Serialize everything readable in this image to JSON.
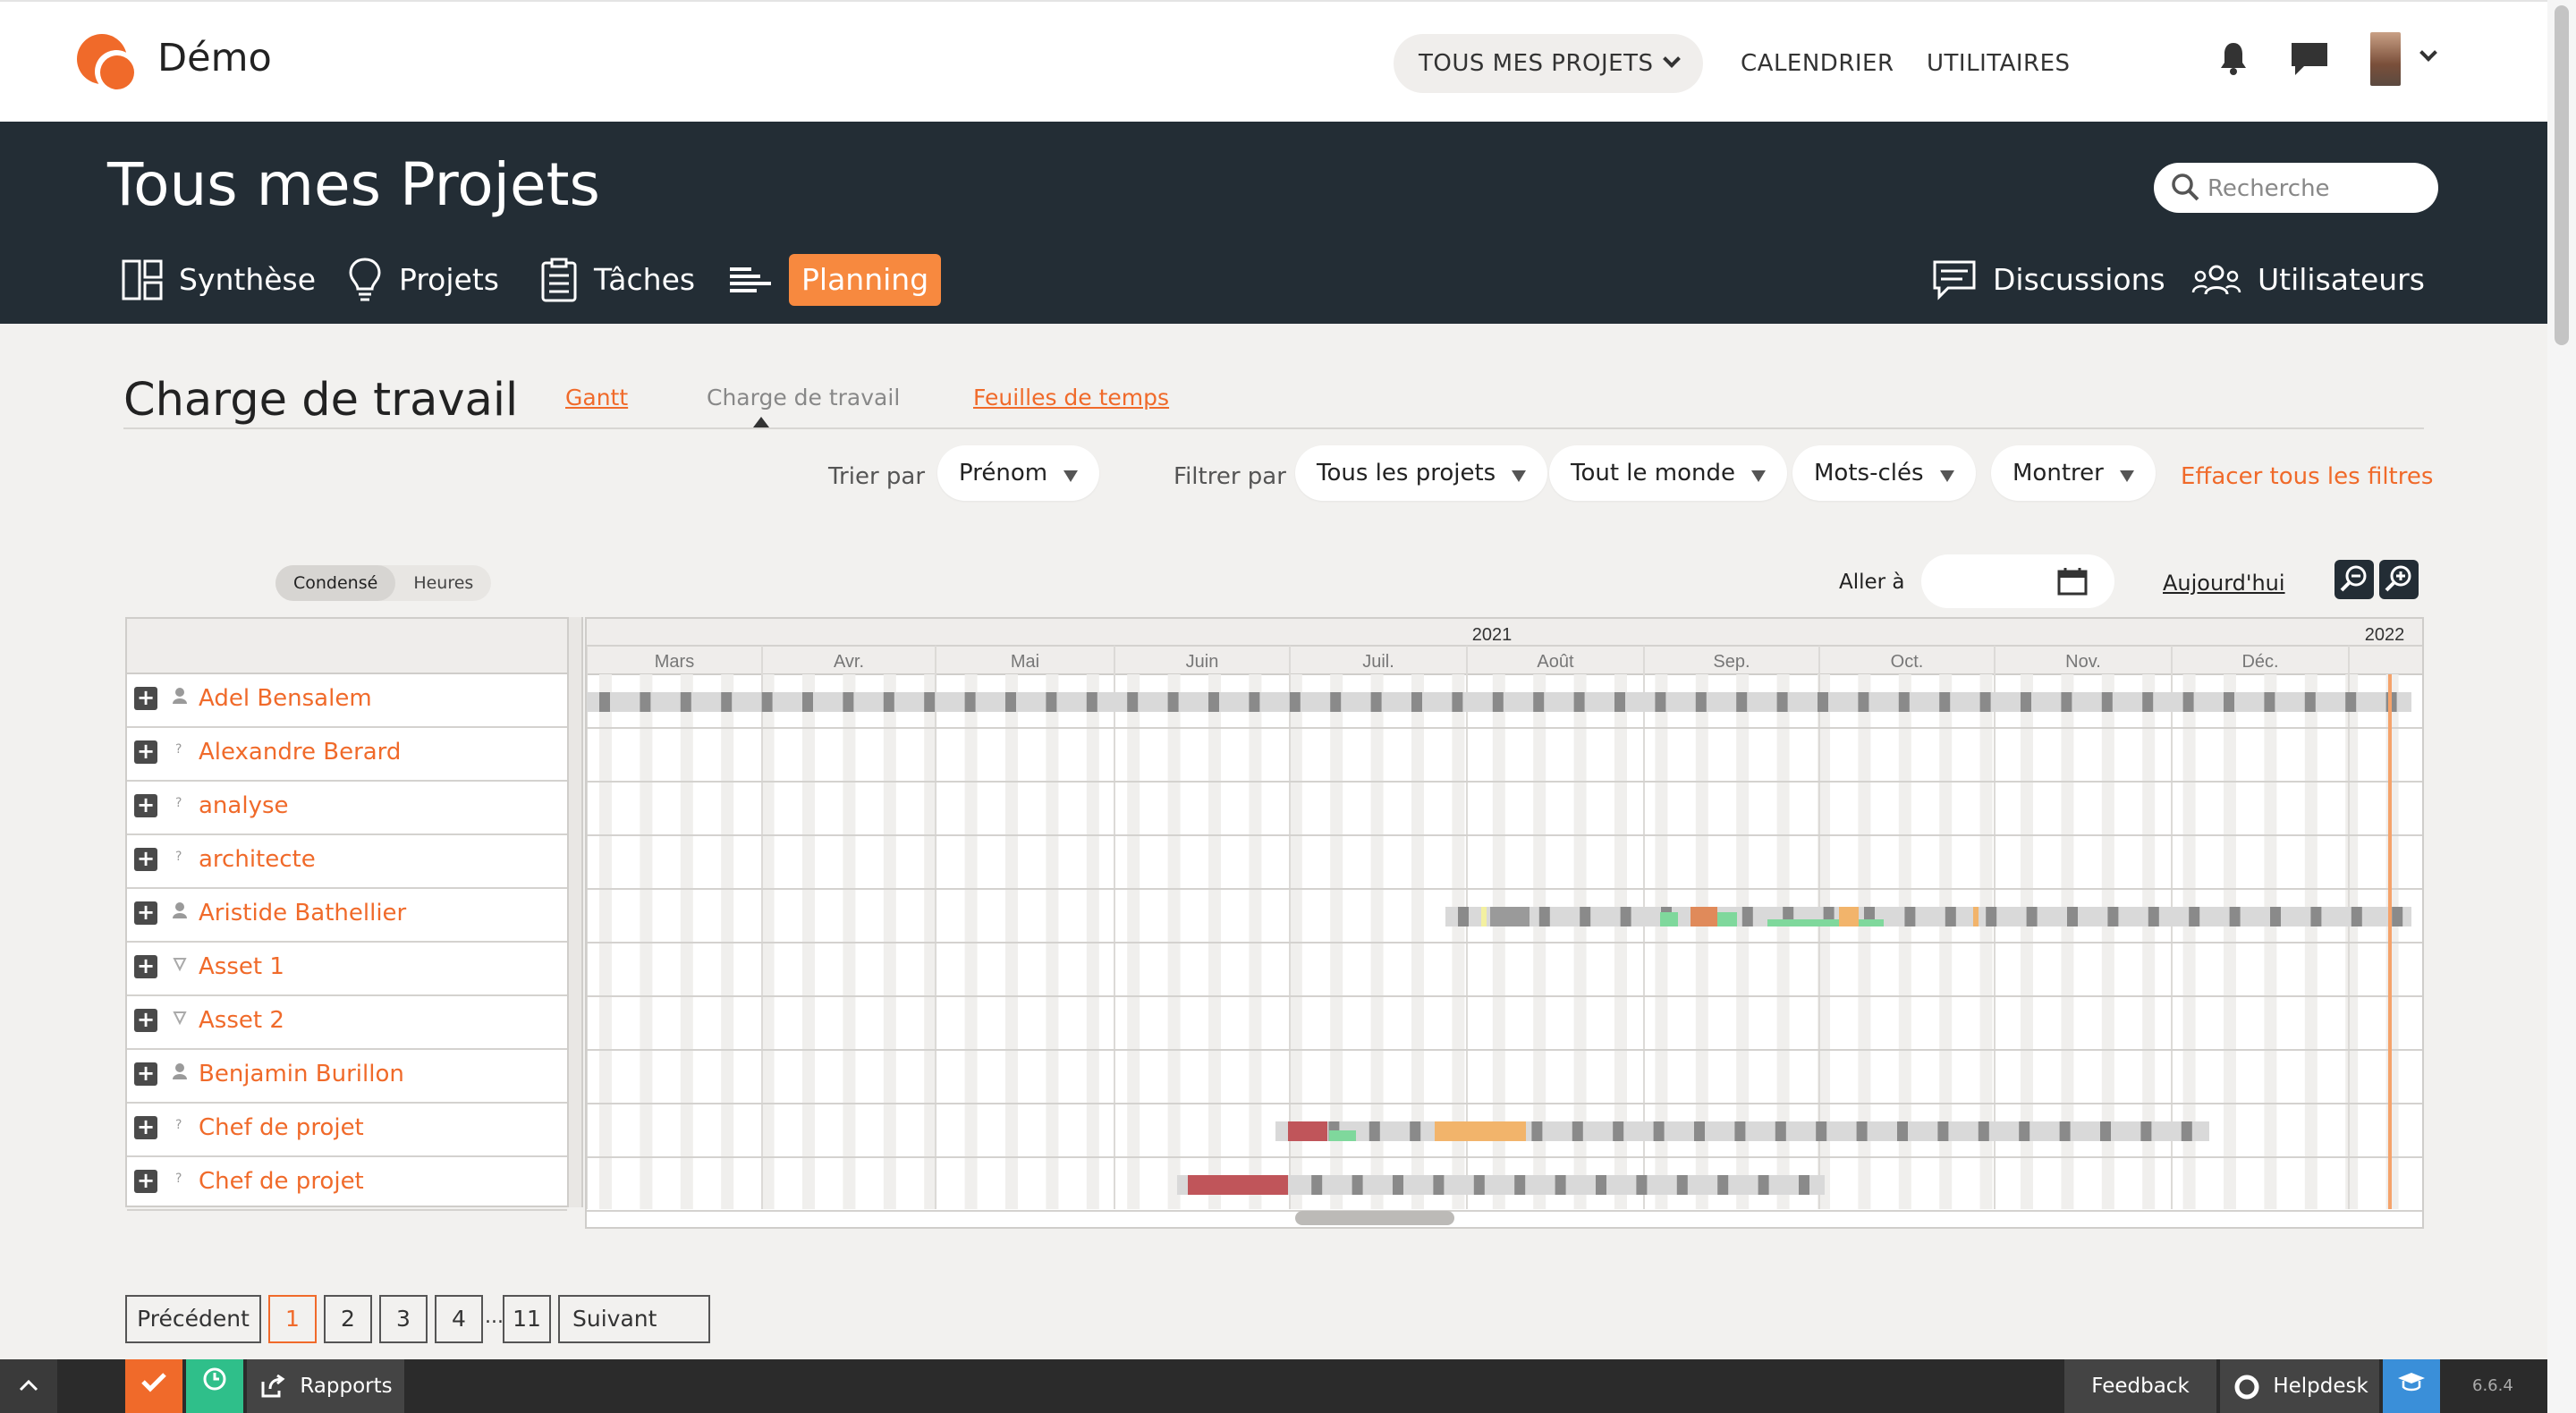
{
  "app": {
    "brand": "Démo",
    "topnav": {
      "projects_label": "TOUS MES PROJETS",
      "calendar_label": "CALENDRIER",
      "utilities_label": "UTILITAIRES"
    }
  },
  "header": {
    "title": "Tous mes Projets",
    "search_placeholder": "Recherche",
    "tabs": [
      {
        "label": "Synthèse",
        "icon": "dashboard-icon"
      },
      {
        "label": "Projets",
        "icon": "lightbulb-icon"
      },
      {
        "label": "Tâches",
        "icon": "clipboard-icon"
      },
      {
        "label": "Planning",
        "icon": "planning-icon",
        "active": true
      }
    ],
    "right_tabs": [
      {
        "label": "Discussions",
        "icon": "chat-icon"
      },
      {
        "label": "Utilisateurs",
        "icon": "users-icon"
      }
    ]
  },
  "section": {
    "title": "Charge de travail",
    "subtabs": [
      {
        "label": "Gantt",
        "link": true
      },
      {
        "label": "Charge de travail",
        "active": true
      },
      {
        "label": "Feuilles de temps",
        "link": true
      }
    ]
  },
  "filters": {
    "sort_label": "Trier par",
    "sort_value": "Prénom",
    "filter_label": "Filtrer par",
    "projects_value": "Tous les projets",
    "people_value": "Tout le monde",
    "keywords_value": "Mots-clés",
    "show_value": "Montrer",
    "clear_label": "Effacer tous les filtres"
  },
  "view": {
    "mode_condensed": "Condensé",
    "mode_hours": "Heures",
    "goto_label": "Aller à",
    "goto_value": "",
    "today_label": "Aujourd'hui"
  },
  "timeline": {
    "years": [
      "2021",
      "2022"
    ],
    "months": [
      "Mars",
      "Avr.",
      "Mai",
      "Juin",
      "Juil.",
      "Août",
      "Sep.",
      "Oct.",
      "Nov.",
      "Déc."
    ]
  },
  "resources": [
    {
      "name": "Adel Bensalem",
      "type": "user"
    },
    {
      "name": "Alexandre Berard",
      "type": "unknown"
    },
    {
      "name": "analyse",
      "type": "unknown"
    },
    {
      "name": "architecte",
      "type": "unknown"
    },
    {
      "name": "Aristide Bathellier",
      "type": "user"
    },
    {
      "name": "Asset 1",
      "type": "asset"
    },
    {
      "name": "Asset 2",
      "type": "asset"
    },
    {
      "name": "Benjamin Burillon",
      "type": "user"
    },
    {
      "name": "Chef de projet",
      "type": "unknown"
    },
    {
      "name": "Chef de projet",
      "type": "unknown"
    }
  ],
  "pagination": {
    "prev": "Précédent",
    "pages": [
      "1",
      "2",
      "3",
      "4"
    ],
    "ellipsis": "...",
    "last": "11",
    "next": "Suivant",
    "current": "1"
  },
  "footer": {
    "reports": "Rapports",
    "feedback": "Feedback",
    "helpdesk": "Helpdesk",
    "version": "6.6.4"
  },
  "colors": {
    "accent": "#f06a2a",
    "header_bg": "#232d35",
    "overload": "#c0555a",
    "high": "#f2b46b",
    "low": "#7fd89c",
    "today_line": "#f5a36b"
  }
}
